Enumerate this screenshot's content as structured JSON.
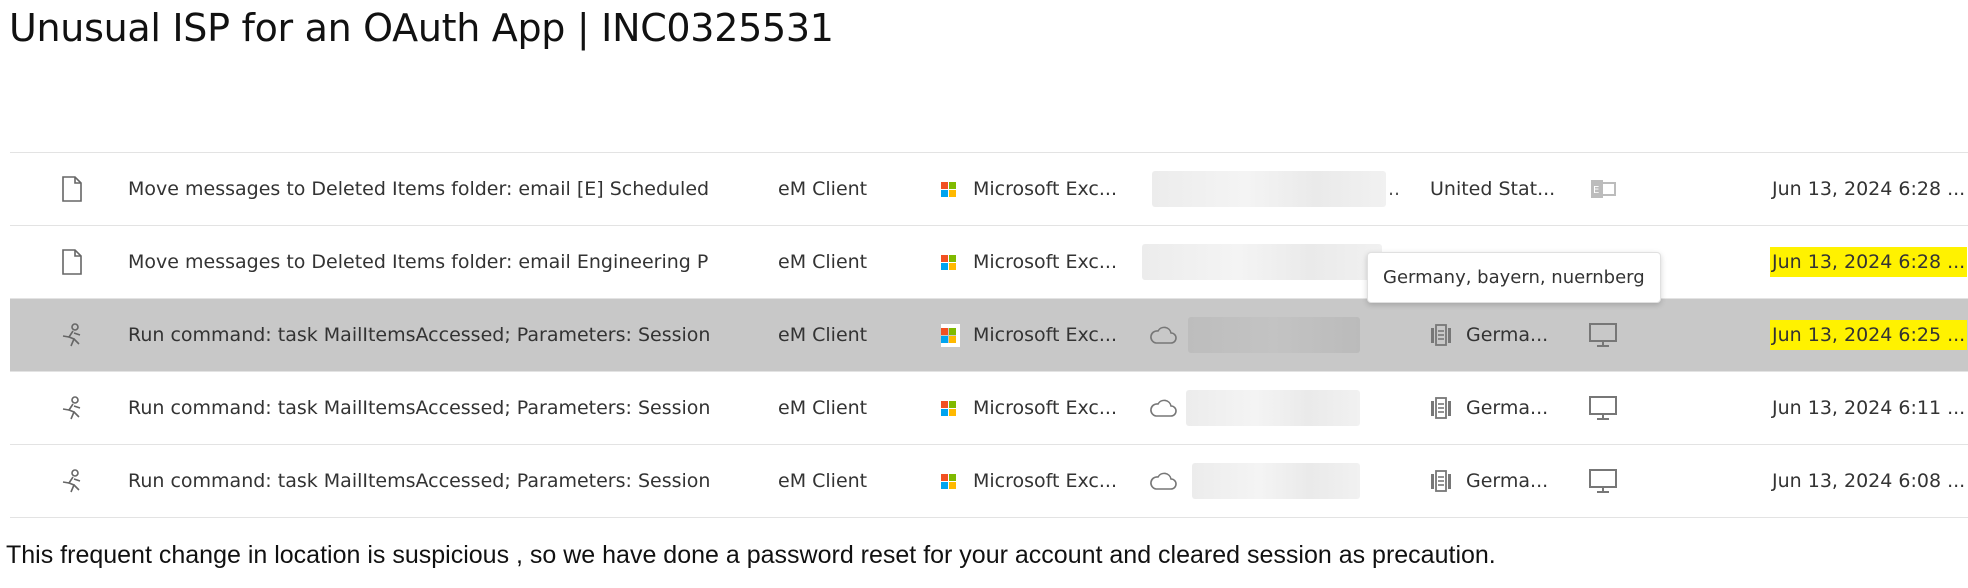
{
  "page": {
    "title": "Unusual ISP for an OAuth App | INC0325531",
    "footer_note": "This frequent change in location is suspicious , so we have done a password reset for your account and cleared session as precaution."
  },
  "tooltip": {
    "text": "Germany, bayern, nuernberg"
  },
  "colors": {
    "highlight": "#fff200",
    "selected_row": "#c8c8c8",
    "ms_red": "#f25022",
    "ms_green": "#7fba00",
    "ms_blue": "#00a4ef",
    "ms_yellow": "#ffb900"
  },
  "rows": [
    {
      "icon": "document-icon",
      "activity": "Move messages to Deleted Items folder: email [E] Scheduled",
      "app": "eM Client",
      "service": "Microsoft Exc...",
      "ip_suffix": "..",
      "location": "United Stat...",
      "device_icon": "exchange-icon",
      "date": "Jun 13, 2024 6:28 ...",
      "highlighted": false,
      "selected": false
    },
    {
      "icon": "document-icon",
      "activity": "Move messages to Deleted Items folder: email Engineering P",
      "app": "eM Client",
      "service": "Microsoft Exc...",
      "ip_suffix": "",
      "location": "",
      "device_icon": "",
      "date": "Jun 13, 2024 6:28 ...",
      "highlighted": true,
      "selected": false
    },
    {
      "icon": "run-command-icon",
      "activity": "Run command: task MailItemsAccessed; Parameters: Session",
      "app": "eM Client",
      "service": "Microsoft Exc...",
      "ip_suffix": "",
      "location": "Germa...",
      "device_icon": "monitor-icon",
      "date": "Jun 13, 2024 6:25 ...",
      "highlighted": true,
      "selected": true
    },
    {
      "icon": "run-command-icon",
      "activity": "Run command: task MailItemsAccessed; Parameters: Session",
      "app": "eM Client",
      "service": "Microsoft Exc...",
      "ip_suffix": "",
      "location": "Germa...",
      "device_icon": "monitor-icon",
      "date": "Jun 13, 2024 6:11 ...",
      "highlighted": false,
      "selected": false
    },
    {
      "icon": "run-command-icon",
      "activity": "Run command: task MailItemsAccessed; Parameters: Session",
      "app": "eM Client",
      "service": "Microsoft Exc...",
      "ip_suffix": "",
      "location": "Germa...",
      "device_icon": "monitor-icon",
      "date": "Jun 13, 2024 6:08 ...",
      "highlighted": false,
      "selected": false
    }
  ]
}
